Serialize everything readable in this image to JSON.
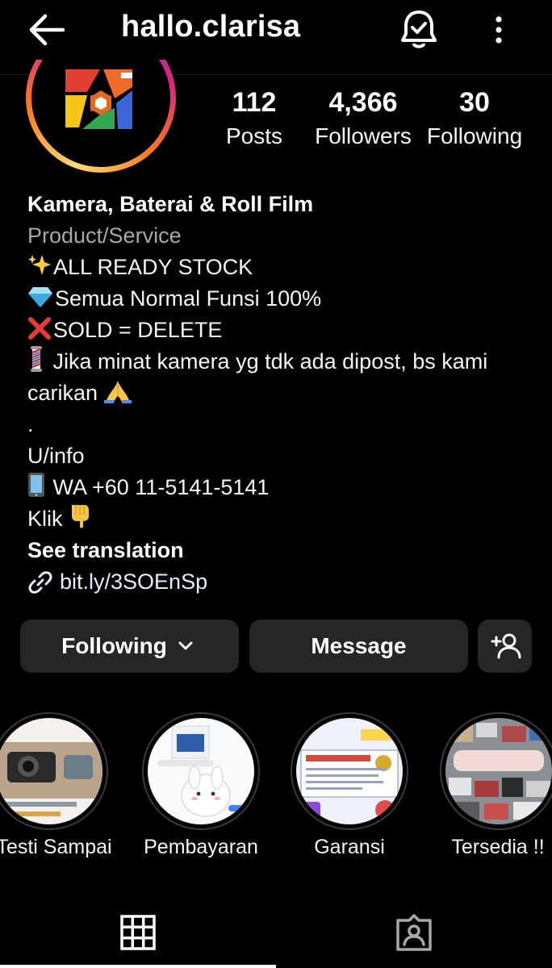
{
  "header": {
    "username": "hallo.clarisa",
    "back_icon": "arrow-left-icon",
    "bell_icon": "notification-bell-check-icon",
    "more_icon": "more-vertical-icon"
  },
  "stats": {
    "posts": {
      "value": "112",
      "label": "Posts"
    },
    "followers": {
      "value": "4,366",
      "label": "Followers"
    },
    "following": {
      "value": "30",
      "label": "Following"
    }
  },
  "bio": {
    "name": "Kamera, Baterai & Roll Film",
    "category": "Product/Service",
    "lines": [
      "ALL READY STOCK",
      "Semua Normal Funsi 100%",
      "SOLD = DELETE",
      " Jika minat kamera yg tdk ada dipost, bs kami carikan",
      ".",
      "U/info",
      " WA +60 11-5141-5141",
      "Klik"
    ],
    "see_translation": "See translation",
    "link": "bit.ly/3SOEnSp"
  },
  "actions": {
    "following_label": "Following",
    "message_label": "Message",
    "add_icon": "add-person-icon"
  },
  "highlights": [
    {
      "label": "Testi Sampai"
    },
    {
      "label": "Pembayaran"
    },
    {
      "label": "Garansi"
    },
    {
      "label": "Tersedia !!"
    }
  ],
  "tabs": {
    "active": "grid",
    "items": [
      "grid-icon",
      "tagged-icon"
    ]
  },
  "colors": {
    "background": "#000000",
    "button": "#262626",
    "secondary_text": "#a8a8a8"
  }
}
